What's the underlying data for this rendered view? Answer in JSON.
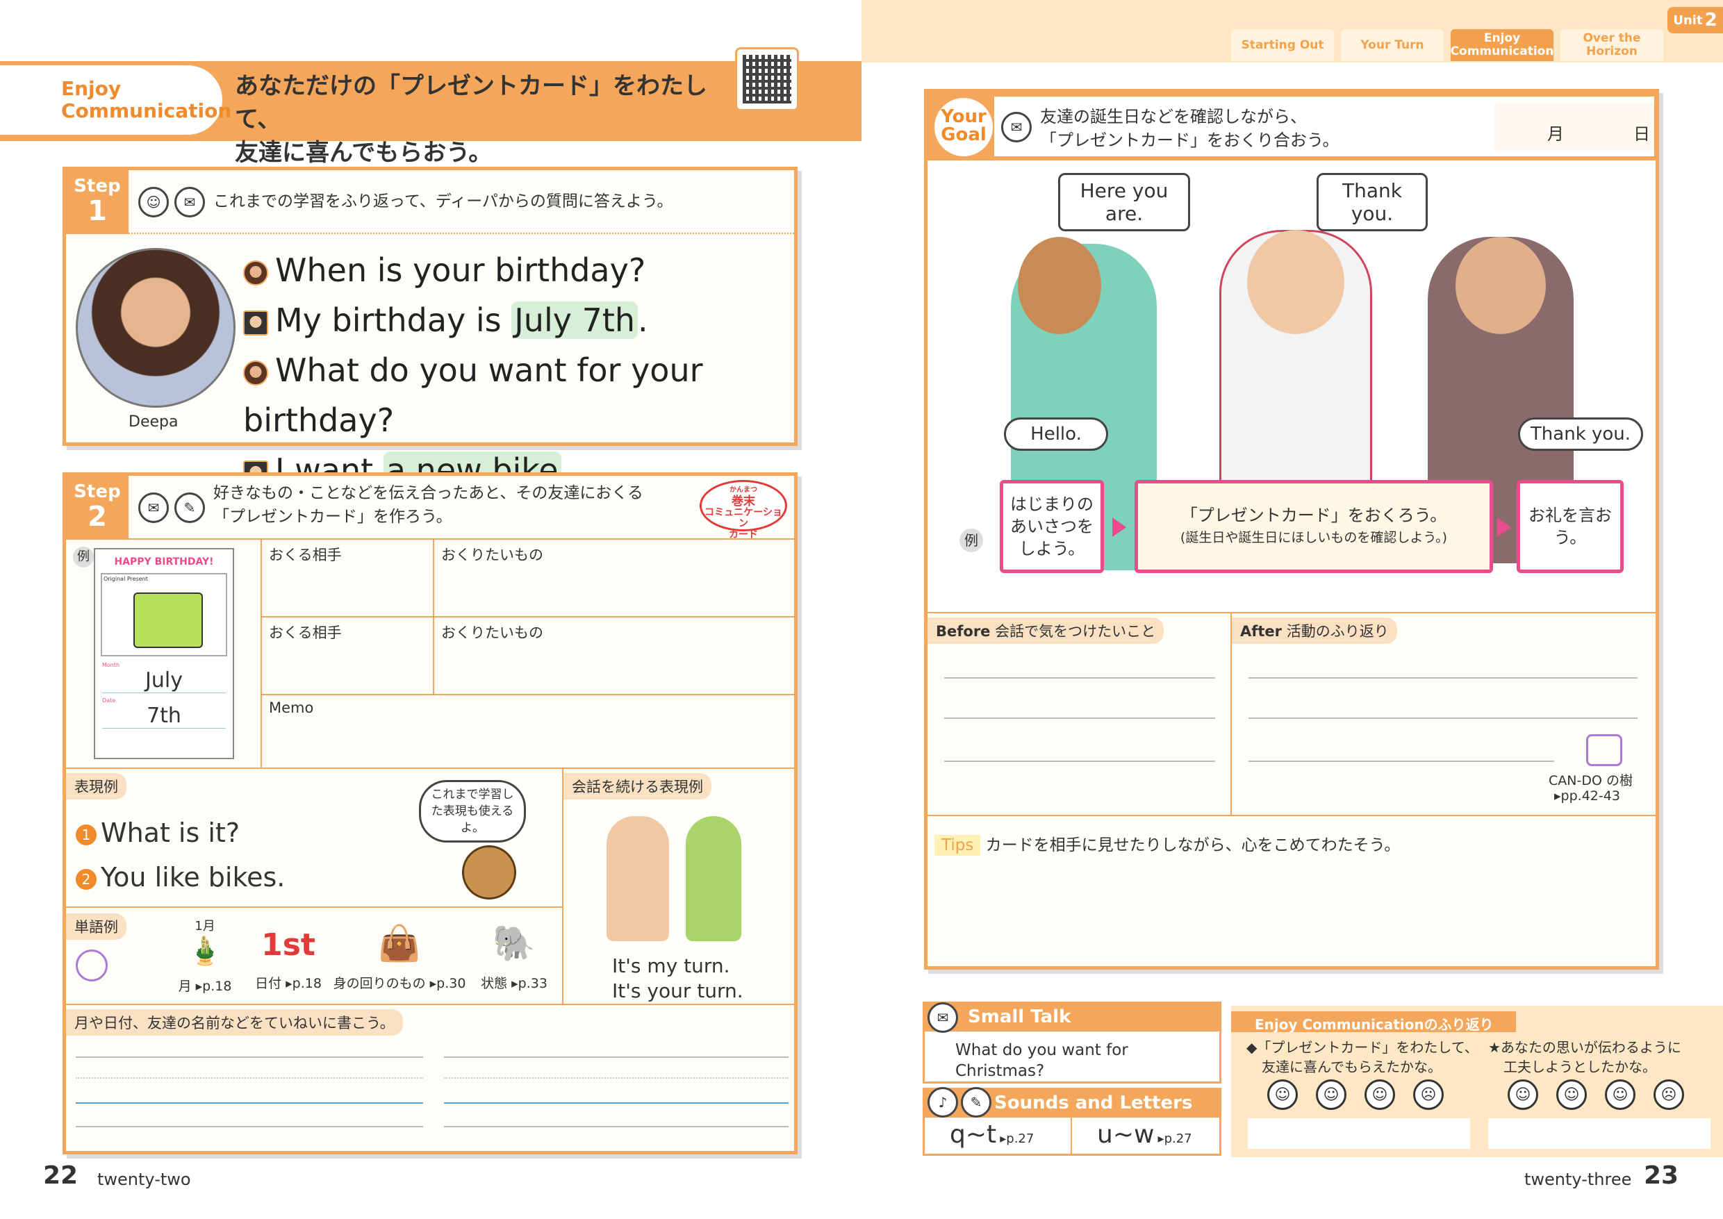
{
  "nav": {
    "tabs": [
      "Starting Out",
      "Your Turn",
      "Enjoy Communication",
      "Over the Horizon"
    ],
    "active_tab": "Enjoy Communication",
    "unit_label": "Unit",
    "unit_number": "2"
  },
  "left_header": {
    "section_line1": "Enjoy",
    "section_line2": "Communication",
    "title_line1": "あなただけの「プレゼントカード」をわたして、",
    "title_line2": "友達に喜んでもらおう。"
  },
  "step1": {
    "label": "Step",
    "number": "1",
    "instruction": "これまでの学習をふり返って、ディーパからの質問に答えよう。",
    "person_name": "Deepa",
    "lines": [
      {
        "pre": "When is your birthday?",
        "hl": "",
        "post": ""
      },
      {
        "pre": "My birthday is ",
        "hl": "July 7th",
        "post": "."
      },
      {
        "pre": "What do you want for your birthday?",
        "hl": "",
        "post": ""
      },
      {
        "pre": "I want ",
        "hl": "a new bike",
        "post": "."
      }
    ]
  },
  "step2": {
    "label": "Step",
    "number": "2",
    "instruction_line1": "好きなもの・ことなどを伝え合ったあと、その友達におくる",
    "instruction_line2": "「プレゼントカード」を作ろう。",
    "badge_small": "かんまつ",
    "badge_line1": "巻末",
    "badge_line2": "コミュニケーション",
    "badge_line3": "カード",
    "example_label": "例",
    "card": {
      "banner": "HAPPY BIRTHDAY!",
      "sub": "Original Present",
      "month_label": "Month",
      "month": "July",
      "date_label": "Date",
      "date": "7th"
    },
    "col_recipient": "おくる相手",
    "col_gift": "おくりたいもの",
    "memo": "Memo",
    "expressions_label": "表現例",
    "expressions": [
      "What is it?",
      "You like bikes."
    ],
    "bubble_text": "これまで学習した表現も使えるよ。",
    "continue_label": "会話を続ける表現例",
    "continue_lines": [
      "It's my turn.",
      "It's your turn."
    ],
    "words_label": "単語例",
    "words": [
      {
        "top": "1月",
        "label": "月",
        "page": "p.18"
      },
      {
        "top": "1st",
        "label": "日付",
        "page": "p.18"
      },
      {
        "top": "",
        "label": "身の回りのもの",
        "page": "p.30"
      },
      {
        "top": "",
        "label": "状態",
        "page": "p.33"
      }
    ],
    "write_note": "月や日付、友達の名前などをていねいに書こう。"
  },
  "left_footer": {
    "page_number": "22",
    "page_word": "twenty-two"
  },
  "your_goal": {
    "label_line1": "Your",
    "label_line2": "Goal",
    "text_line1": "友達の誕生日などを確認しながら、",
    "text_line2": "「プレゼントカード」をおくり合おう。",
    "month": "月",
    "day": "日"
  },
  "scene": {
    "bubble_left": "Here you are.",
    "bubble_right": "Thank you.",
    "bubble_hello": "Hello.",
    "bubble_thanks": "Thank you.",
    "example_label": "例",
    "flow": [
      "はじまりのあいさつをしよう。",
      "「プレゼントカード」をおくろう。",
      "お礼を言おう。"
    ],
    "flow_sub": "(誕生日や誕生日にほしいものを確認しよう。)"
  },
  "reflection": {
    "before_label": "Before",
    "before_text": "会話で気をつけたいこと",
    "after_label": "After",
    "after_text": "活動のふり返り",
    "cando": "CAN-DO の樹",
    "cando_pages": "pp.42-43",
    "tips_label": "Tips",
    "tips_text": "カードを相手に見せたりしながら、心をこめてわたそう。"
  },
  "small_talk": {
    "title": "Small Talk",
    "question_line1": "What do you want for",
    "question_line2": "Christmas?"
  },
  "sounds": {
    "title": "Sounds and Letters",
    "items": [
      {
        "letters": "q~t",
        "page": "p.27"
      },
      {
        "letters": "u~w",
        "page": "p.27"
      }
    ]
  },
  "review": {
    "title": "Enjoy Communicationのふり返り",
    "q1_line1": "「プレゼントカード」をわたして、",
    "q1_line2": "友達に喜んでもらえたかな。",
    "q2_line1": "あなたの思いが伝わるように",
    "q2_line2": "工夫しようとしたかな。"
  },
  "right_footer": {
    "page_word": "twenty-three",
    "page_number": "23"
  }
}
